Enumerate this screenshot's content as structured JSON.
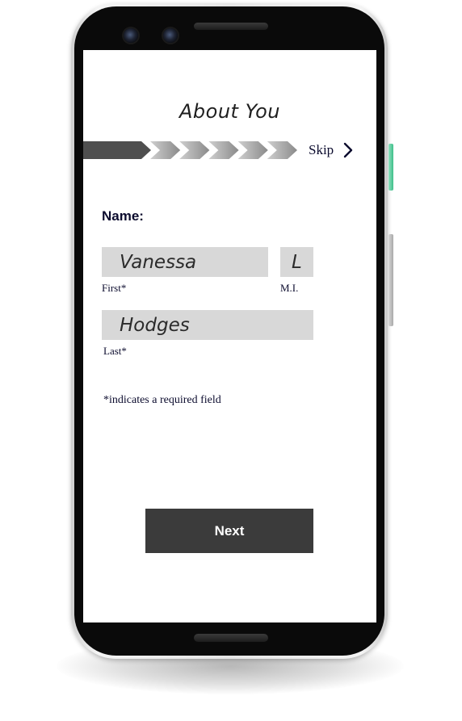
{
  "screen": {
    "title": "About You",
    "progress": {
      "total_steps": 6,
      "current_step": 1,
      "colors": {
        "completed": "#4f4f4f",
        "remaining_light": "#cfcfcf",
        "remaining_dark": "#8a8a8a"
      }
    },
    "skip": {
      "label": "Skip",
      "icon": "chevron-right-icon"
    },
    "name_section": {
      "label": "Name:",
      "first": {
        "value": "Vanessa",
        "caption": "First*"
      },
      "middle_initial": {
        "value": "L",
        "caption": "M.I."
      },
      "last": {
        "value": "Hodges",
        "caption": "Last*"
      }
    },
    "required_note": "*indicates a required field",
    "next_button": {
      "label": "Next",
      "color": "#3b3b3b"
    }
  },
  "device": {
    "accent_button_color": "#3fbf8a"
  }
}
